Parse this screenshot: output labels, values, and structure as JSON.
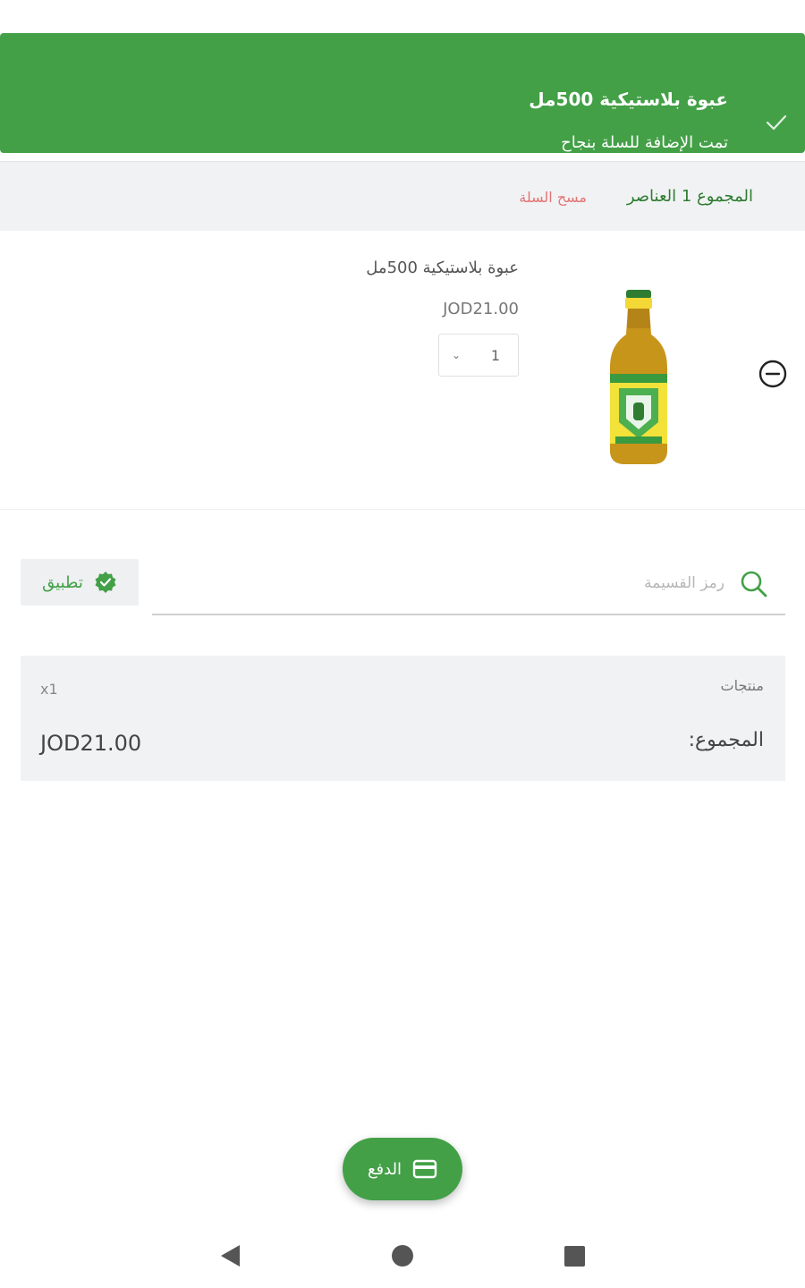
{
  "toast": {
    "title": "عبوة بلاستيكية 500مل",
    "message": "تمت الإضافة للسلة بنجاح",
    "icon": "checkmark-icon"
  },
  "cart_summary": {
    "total_items_label": "المجموع 1 العناصر",
    "clear_cart_label": "مسح السلة"
  },
  "cart_item": {
    "name": "عبوة بلاستيكية 500مل",
    "price": "JOD21.00",
    "quantity": "1",
    "remove_icon": "minus-circle-icon"
  },
  "coupon": {
    "placeholder": "رمز القسيمة",
    "value": "",
    "apply_label": "تطبيق"
  },
  "totals": {
    "products_label": "منتجات",
    "products_count": "x1",
    "total_label": "المجموع:",
    "total_value": "JOD21.00"
  },
  "checkout": {
    "pay_label": "الدفع",
    "icon": "credit-card-icon"
  },
  "colors": {
    "primary": "#43a047",
    "danger": "#e57373",
    "panel": "#f1f2f4"
  }
}
